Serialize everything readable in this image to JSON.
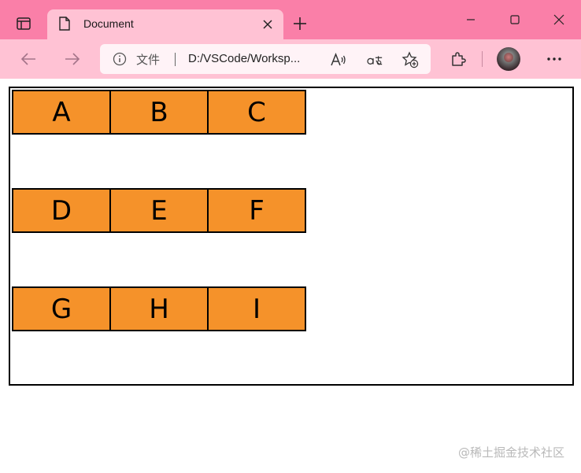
{
  "browser": {
    "tab_title": "Document",
    "address": {
      "site_label": "文件",
      "url": "D:/VSCode/Worksp..."
    }
  },
  "page": {
    "cells": [
      {
        "label": "A"
      },
      {
        "label": "B"
      },
      {
        "label": "C"
      },
      {
        "label": "D"
      },
      {
        "label": "E"
      },
      {
        "label": "F"
      },
      {
        "label": "G"
      },
      {
        "label": "H"
      },
      {
        "label": "I"
      }
    ]
  },
  "watermark": "@稀土掘金技术社区",
  "colors": {
    "titlebar": "#fa7fa8",
    "toolbar": "#ffc2d4",
    "cell_fill": "#f5922a",
    "cell_border": "#000000"
  }
}
